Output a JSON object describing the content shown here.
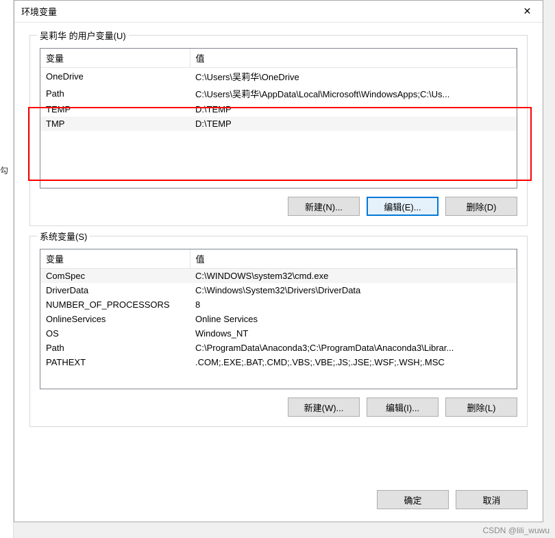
{
  "window": {
    "title": "环境变量",
    "close_glyph": "✕"
  },
  "user_group": {
    "label": "吴莉华 的用户变量(U)",
    "col_var": "变量",
    "col_val": "值",
    "rows": [
      {
        "var": "OneDrive",
        "val": "C:\\Users\\吴莉华\\OneDrive"
      },
      {
        "var": "Path",
        "val": "C:\\Users\\吴莉华\\AppData\\Local\\Microsoft\\WindowsApps;C:\\Us..."
      },
      {
        "var": "TEMP",
        "val": "D:\\TEMP"
      },
      {
        "var": "TMP",
        "val": "D:\\TEMP"
      }
    ],
    "btn_new": "新建(N)...",
    "btn_edit": "编辑(E)...",
    "btn_delete": "删除(D)"
  },
  "sys_group": {
    "label": "系统变量(S)",
    "col_var": "变量",
    "col_val": "值",
    "rows": [
      {
        "var": "ComSpec",
        "val": "C:\\WINDOWS\\system32\\cmd.exe"
      },
      {
        "var": "DriverData",
        "val": "C:\\Windows\\System32\\Drivers\\DriverData"
      },
      {
        "var": "NUMBER_OF_PROCESSORS",
        "val": "8"
      },
      {
        "var": "OnlineServices",
        "val": "Online Services"
      },
      {
        "var": "OS",
        "val": "Windows_NT"
      },
      {
        "var": "Path",
        "val": "C:\\ProgramData\\Anaconda3;C:\\ProgramData\\Anaconda3\\Librar..."
      },
      {
        "var": "PATHEXT",
        "val": ".COM;.EXE;.BAT;.CMD;.VBS;.VBE;.JS;.JSE;.WSF;.WSH;.MSC"
      }
    ],
    "btn_new": "新建(W)...",
    "btn_edit": "编辑(I)...",
    "btn_delete": "删除(L)"
  },
  "footer": {
    "ok": "确定",
    "cancel": "取消"
  },
  "watermark": "CSDN @lili_wuwu",
  "left_edge_text": "勾"
}
